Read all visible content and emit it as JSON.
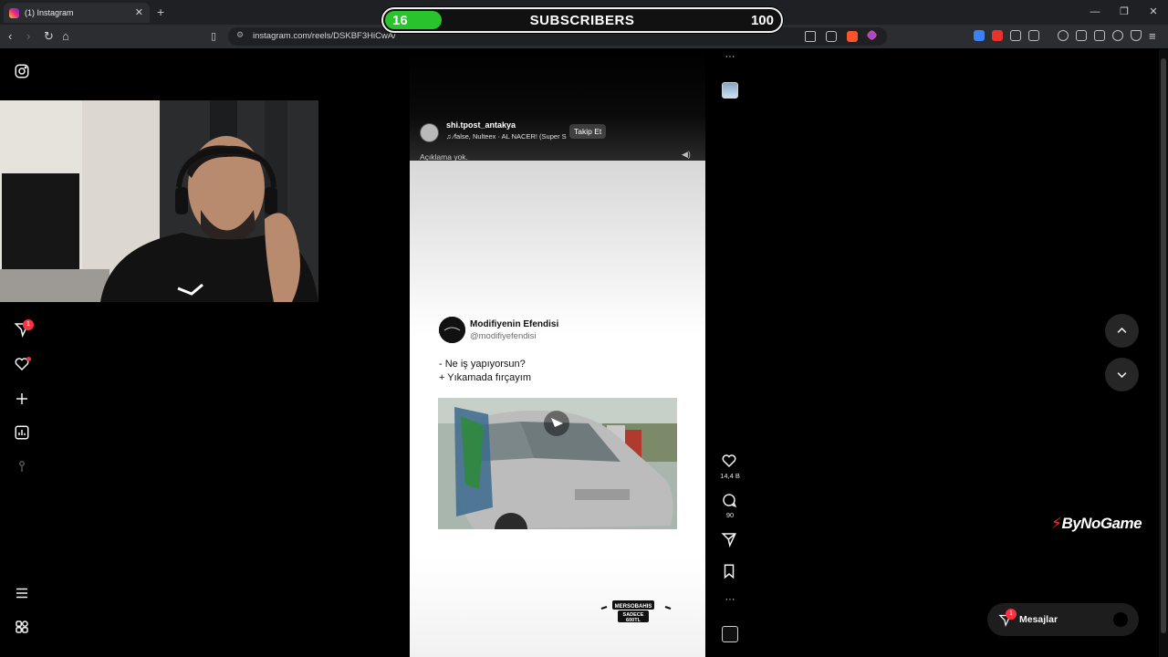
{
  "browser": {
    "tab_title": "(1) Instagram",
    "tab_close": "✕",
    "new_tab": "+",
    "url": "instagram.com/reels/DSKBF3HiCwA/",
    "window_controls": [
      "—",
      "❐",
      "✕"
    ]
  },
  "overlay": {
    "subscribers_current": "16",
    "subscribers_label": "SUBSCRIBERS",
    "subscribers_goal": "100",
    "subscribers_progress": 0.16
  },
  "sidebar": {
    "icons": [
      "instagram-icon",
      "messenger-icon",
      "heart-icon",
      "plus-icon",
      "dashboard-icon",
      "threads-icon",
      "menu-icon",
      "more-apps-icon"
    ],
    "messages_badge": "1"
  },
  "reel": {
    "author": "shi.tpost_antakya",
    "audio": "♫ ⁄false, Nulteex · AL NACER! (Super S",
    "follow_label": "Takip Et",
    "caption": "Açıklama yok.",
    "tweet": {
      "name": "Modifiyenin Efendisi",
      "handle": "@modifiyefendisi",
      "line1": "- Ne iş yapıyorsun?",
      "line2": "+ Yıkamada fırçayım"
    },
    "sponsor": {
      "brand": "MERSOBAHIS",
      "tagline": "SADECE",
      "amount": "600TL"
    }
  },
  "actions": {
    "likes": "14,4 B",
    "comments": "90",
    "more": "···"
  },
  "messages": {
    "label": "Mesajlar",
    "badge": "1"
  },
  "watermark": "ByNoGame",
  "colors": {
    "progress_fill": "#29c42b",
    "notification": "#ff3040",
    "brand_red": "#e8322b"
  }
}
